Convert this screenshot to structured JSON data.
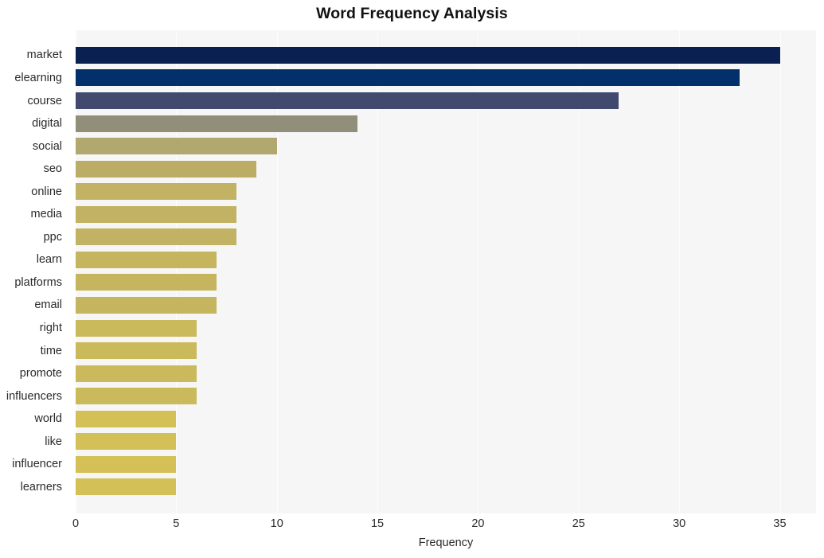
{
  "chart_data": {
    "type": "bar",
    "orientation": "horizontal",
    "title": "Word Frequency Analysis",
    "xlabel": "Frequency",
    "ylabel": "",
    "xlim": [
      0,
      36.8
    ],
    "xticks": [
      0,
      5,
      10,
      15,
      20,
      25,
      30,
      35
    ],
    "grid": true,
    "grid_axis": "x",
    "legend": "none",
    "categories": [
      "market",
      "elearning",
      "course",
      "digital",
      "social",
      "seo",
      "online",
      "media",
      "ppc",
      "learn",
      "platforms",
      "email",
      "right",
      "time",
      "promote",
      "influencers",
      "world",
      "like",
      "influencer",
      "learners"
    ],
    "values": [
      35,
      33,
      27,
      14,
      10,
      9,
      8,
      8,
      8,
      7,
      7,
      7,
      6,
      6,
      6,
      6,
      5,
      5,
      5,
      5
    ],
    "bar_colors": [
      "#0a2050",
      "#02306b",
      "#41496e",
      "#918e79",
      "#b0a86e",
      "#bcad66",
      "#c2b263",
      "#c2b263",
      "#c2b263",
      "#c5b55f",
      "#c5b55f",
      "#c5b55f",
      "#cbba5c",
      "#cbba5c",
      "#cbba5c",
      "#cbba5c",
      "#d3c157",
      "#d3c157",
      "#d3c157",
      "#d3c157"
    ],
    "plot_background": "#f6f6f7",
    "figure_background": "#ffffff",
    "gridline_color": "#fdfdfd"
  }
}
